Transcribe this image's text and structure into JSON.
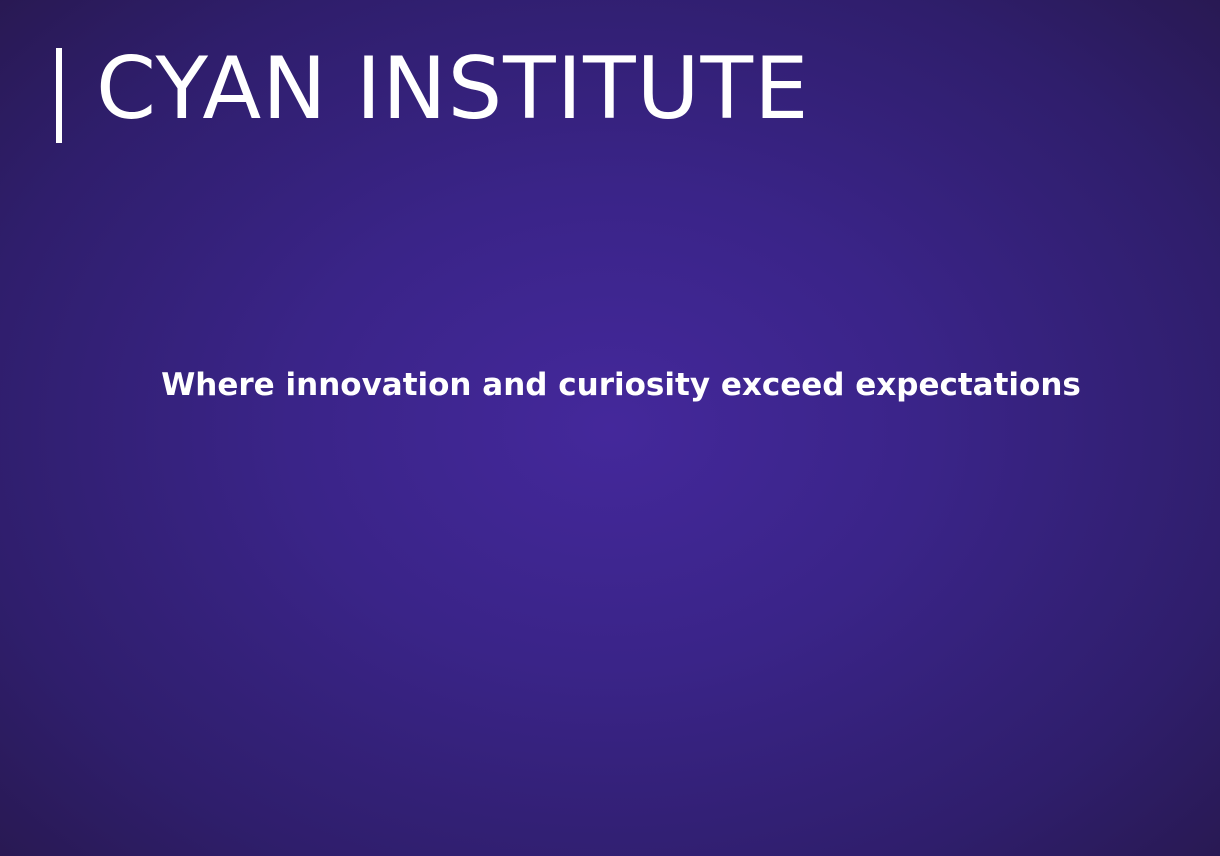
{
  "slide": {
    "title": "CYAN INSTITUTE",
    "tagline": "Where innovation and curiosity exceed expectations"
  },
  "colors": {
    "background_center": "#44289b",
    "background_edge": "#261749",
    "text": "#ffffff"
  }
}
